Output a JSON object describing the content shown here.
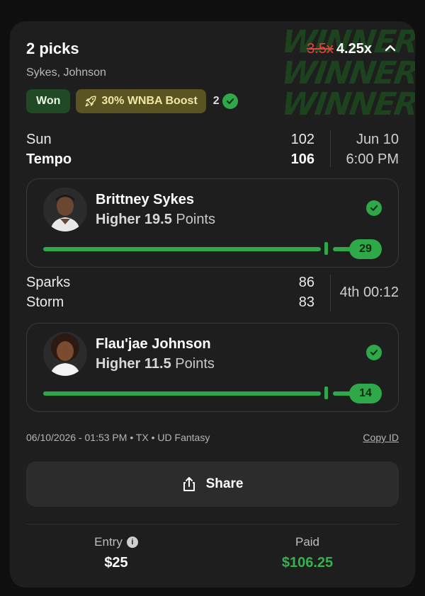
{
  "header": {
    "title": "2 picks",
    "subtitle": "Sykes, Johnson",
    "multiplier_old": "3.5x",
    "multiplier_new": "4.25x"
  },
  "watermark": {
    "text": "WINNER!!"
  },
  "badges": {
    "status": "Won",
    "boost": "30% WNBA Boost",
    "count": "2"
  },
  "games": [
    {
      "team1": "Sun",
      "score1": "102",
      "team2": "Tempo",
      "score2": "106",
      "info1": "Jun 10",
      "info2": "6:00 PM"
    },
    {
      "team1": "Sparks",
      "score1": "86",
      "team2": "Storm",
      "score2": "83",
      "info1": "4th 00:12"
    }
  ],
  "picks": [
    {
      "player": "Brittney Sykes",
      "direction": "Higher",
      "line": "19.5",
      "stat": "Points",
      "result": "29",
      "progress": 1.0
    },
    {
      "player": "Flau'jae Johnson",
      "direction": "Higher",
      "line": "11.5",
      "stat": "Points",
      "result": "14",
      "progress": 1.0
    }
  ],
  "meta": {
    "text": "06/10/2026 - 01:53 PM • TX • UD Fantasy",
    "copy_id": "Copy ID"
  },
  "share": {
    "label": "Share"
  },
  "footer": {
    "entry_label": "Entry",
    "entry_value": "$25",
    "paid_label": "Paid",
    "paid_value": "$106.25"
  },
  "colors": {
    "accent_green": "#2fa84a",
    "paid_green": "#35b24f",
    "strike_red": "#e0463d",
    "boost_bg": "#5a5322",
    "won_bg": "#1f4a24"
  }
}
